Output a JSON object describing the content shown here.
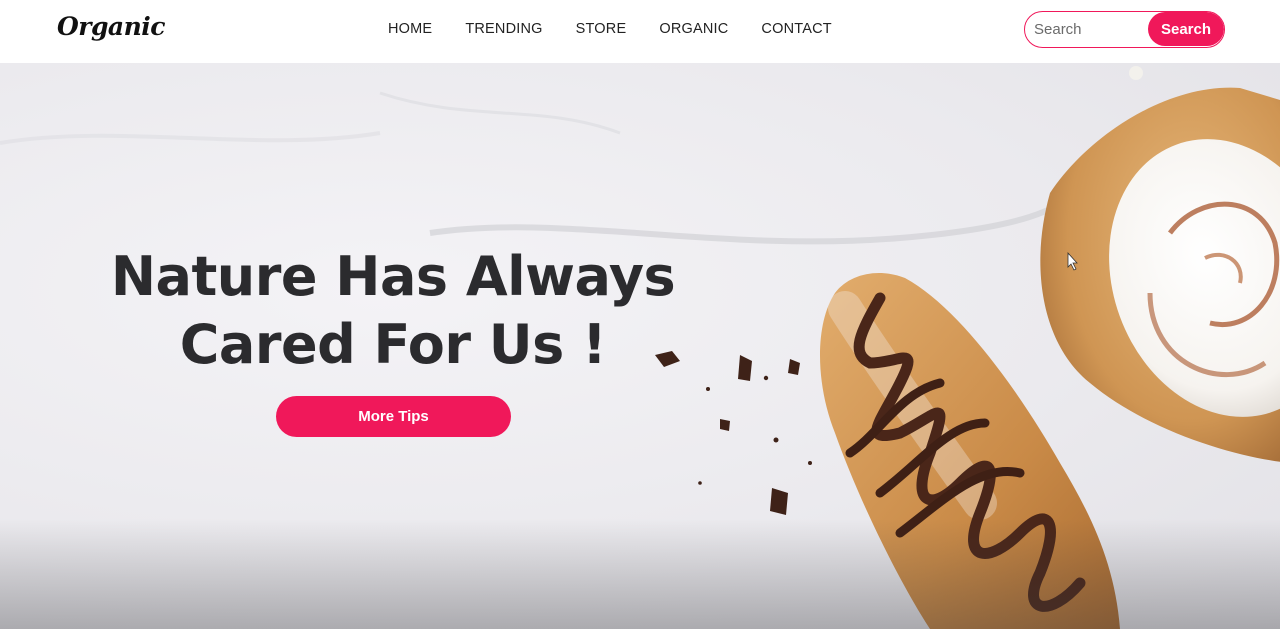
{
  "brand": {
    "logo_text": "Organic"
  },
  "nav": {
    "links": [
      "HOME",
      "TRENDING",
      "STORE",
      "ORGANIC",
      "CONTACT"
    ]
  },
  "search": {
    "placeholder": "Search",
    "value": "",
    "button_label": "Search"
  },
  "hero": {
    "title_line1": "Nature Has Always",
    "title_line2": "Cared For Us !",
    "cta_label": "More Tips"
  },
  "colors": {
    "accent": "#f0185a",
    "title": "#2b2b2e",
    "nav_text": "#222222",
    "background": "#ffffff"
  }
}
